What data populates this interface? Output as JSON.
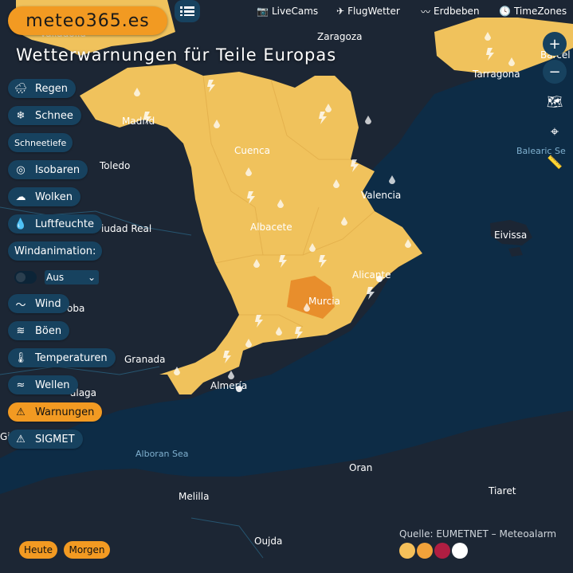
{
  "logo": "meteo365.es",
  "title": "Wetterwarnungen für Teile Europas",
  "nav": [
    {
      "label": "LiveCams",
      "icon": "camera-icon"
    },
    {
      "label": "FlugWetter",
      "icon": "plane-icon"
    },
    {
      "label": "Erdbeben",
      "icon": "seismograph-icon"
    },
    {
      "label": "TimeZones",
      "icon": "clock-icon"
    }
  ],
  "layers": {
    "regen": "Regen",
    "schnee": "Schnee",
    "schneetiefe": "Schneetiefe",
    "isobaren": "Isobaren",
    "wolken": "Wolken",
    "luftfeuchte": "Luftfeuchte",
    "windanimation": "Windanimation:",
    "wind_select": "Aus",
    "wind": "Wind",
    "boeen": "Böen",
    "temperaturen": "Temperaturen",
    "wellen": "Wellen",
    "warnungen": "Warnungen",
    "sigmet": "SIGMET"
  },
  "map_controls": {
    "zoom_in": "+",
    "zoom_out": "−"
  },
  "places": {
    "zaragoza": "Zaragoza",
    "barcelona": "Barcel",
    "tarragona": "Tarragona",
    "madrid": "Madrid",
    "toledo": "Toledo",
    "cuenca": "Cuenca",
    "valencia": "Valencia",
    "balearic": "Balearic Se",
    "ciudad_real": "iudad Real",
    "albacete": "Albacete",
    "eivissa": "Eivissa",
    "alicante": "Alicante",
    "murcia": "Murcia",
    "cordoba": "oba",
    "granada": "Granada",
    "almeria": "Almería",
    "malaga": "álaga",
    "gib": "Gil",
    "alboran": "Alboran Sea",
    "oran": "Oran",
    "tiaret": "Tiaret",
    "melilla": "Melilla",
    "oujda": "Oujda",
    "valladolid": "Valladolid"
  },
  "source": "Quelle: EUMETNET – Meteoalarm",
  "days": {
    "today": "Heute",
    "tomorrow": "Morgen"
  },
  "colors": {
    "land": "#1c2634",
    "sea": "#0d2c46",
    "warn_yellow": "#f0c25c",
    "warn_orange": "#e88e2c",
    "accent": "#f29a22",
    "panel": "#17425f",
    "legend": [
      "#f5c05a",
      "#f2a23a",
      "#b01e42",
      "#ffffff"
    ]
  }
}
